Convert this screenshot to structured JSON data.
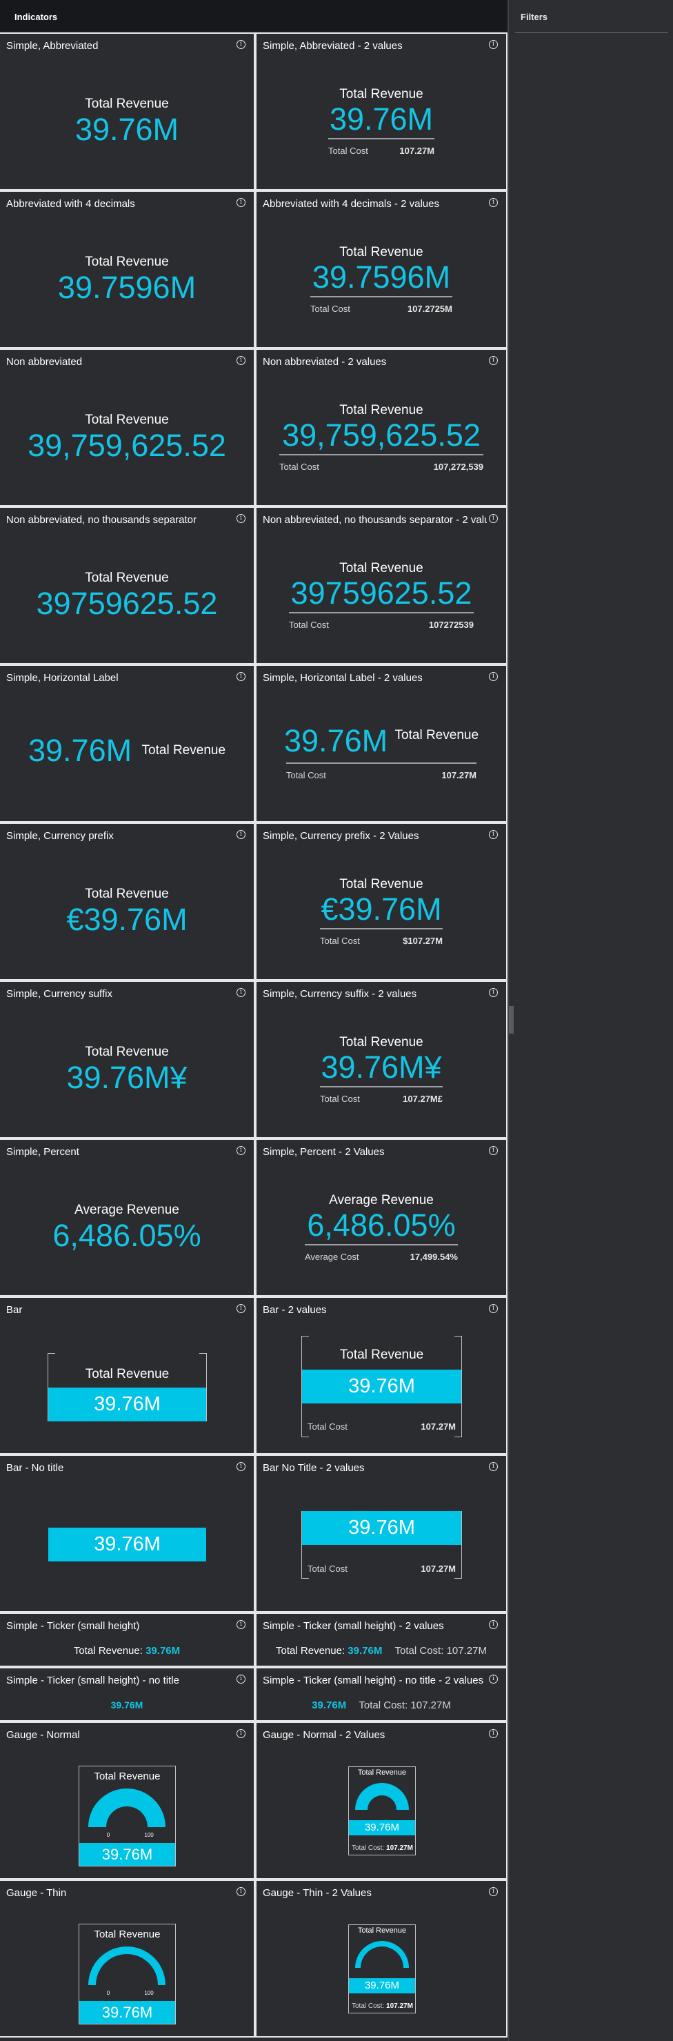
{
  "header": {
    "title": "Indicators"
  },
  "filters": {
    "title": "Filters"
  },
  "cards": {
    "c1": {
      "title": "Simple, Abbreviated",
      "label": "Total Revenue",
      "value": "39.76M"
    },
    "c2": {
      "title": "Simple, Abbreviated - 2 values",
      "label": "Total Revenue",
      "value": "39.76M",
      "sec_label": "Total Cost",
      "sec_value": "107.27M"
    },
    "c3": {
      "title": "Abbreviated with 4 decimals",
      "label": "Total Revenue",
      "value": "39.7596M"
    },
    "c4": {
      "title": "Abbreviated with 4 decimals - 2 values",
      "label": "Total Revenue",
      "value": "39.7596M",
      "sec_label": "Total Cost",
      "sec_value": "107.2725M"
    },
    "c5": {
      "title": "Non abbreviated",
      "label": "Total Revenue",
      "value": "39,759,625.52"
    },
    "c6": {
      "title": "Non abbreviated - 2 values",
      "label": "Total Revenue",
      "value": "39,759,625.52",
      "sec_label": "Total Cost",
      "sec_value": "107,272,539"
    },
    "c7": {
      "title": "Non abbreviated, no thousands separator",
      "label": "Total Revenue",
      "value": "39759625.52"
    },
    "c8": {
      "title": "Non abbreviated, no thousands separator - 2 valu",
      "label": "Total Revenue",
      "value": "39759625.52",
      "sec_label": "Total Cost",
      "sec_value": "107272539"
    },
    "c9": {
      "title": "Simple, Horizontal Label",
      "label": "Total Revenue",
      "value": "39.76M"
    },
    "c10": {
      "title": "Simple, Horizontal Label - 2 values",
      "label": "Total Revenue",
      "value": "39.76M",
      "sec_label": "Total Cost",
      "sec_value": "107.27M"
    },
    "c11": {
      "title": "Simple, Currency prefix",
      "label": "Total Revenue",
      "value": "€39.76M"
    },
    "c12": {
      "title": "Simple, Currency prefix - 2 Values",
      "label": "Total Revenue",
      "value": "€39.76M",
      "sec_label": "Total Cost",
      "sec_value": "$107.27M"
    },
    "c13": {
      "title": "Simple, Currency suffix",
      "label": "Total Revenue",
      "value": "39.76M¥"
    },
    "c14": {
      "title": "Simple, Currency suffix - 2 values",
      "label": "Total Revenue",
      "value": "39.76M¥",
      "sec_label": "Total Cost",
      "sec_value": "107.27M£"
    },
    "c15": {
      "title": "Simple, Percent",
      "label": "Average Revenue",
      "value": "6,486.05%"
    },
    "c16": {
      "title": "Simple, Percent - 2 Values",
      "label": "Average Revenue",
      "value": "6,486.05%",
      "sec_label": "Average Cost",
      "sec_value": "17,499.54%"
    },
    "c17": {
      "title": "Bar",
      "label": "Total Revenue",
      "value": "39.76M"
    },
    "c18": {
      "title": "Bar - 2 values",
      "label": "Total Revenue",
      "value": "39.76M",
      "sec_label": "Total Cost",
      "sec_value": "107.27M"
    },
    "c19": {
      "title": "Bar - No title",
      "value": "39.76M"
    },
    "c20": {
      "title": "Bar No Title - 2 values",
      "value": "39.76M",
      "sec_label": "Total Cost",
      "sec_value": "107.27M"
    },
    "c21": {
      "title": "Simple - Ticker (small height)",
      "label": "Total Revenue:",
      "value": "39.76M"
    },
    "c22": {
      "title": "Simple - Ticker (small height) - 2 values",
      "label": "Total Revenue:",
      "value": "39.76M",
      "sec_label": "Total Cost:",
      "sec_value": "107.27M"
    },
    "c23": {
      "title": "Simple - Ticker (small height) - no title",
      "value": "39.76M"
    },
    "c24": {
      "title": "Simple - Ticker (small height) - no title - 2 values",
      "value": "39.76M",
      "sec_label": "Total Cost:",
      "sec_value": "107.27M"
    },
    "c25": {
      "title": "Gauge - Normal",
      "label": "Total Revenue",
      "value": "39.76M",
      "min": "0",
      "max": "100"
    },
    "c26": {
      "title": "Gauge - Normal - 2 Values",
      "label": "Total Revenue",
      "value": "39.76M",
      "sec_label": "Total Cost:",
      "sec_value": "107.27M"
    },
    "c27": {
      "title": "Gauge - Thin",
      "label": "Total Revenue",
      "value": "39.76M",
      "min": "0",
      "max": "100"
    },
    "c28": {
      "title": "Gauge - Thin - 2 Values",
      "label": "Total Revenue",
      "value": "39.76M",
      "sec_label": "Total Cost:",
      "sec_value": "107.27M"
    }
  },
  "colors": {
    "accent": "#13c4e5",
    "bar": "#00c5e6",
    "background": "#2b2c30",
    "border": "#e4e6ea"
  },
  "icons": {
    "info": "info-icon"
  }
}
